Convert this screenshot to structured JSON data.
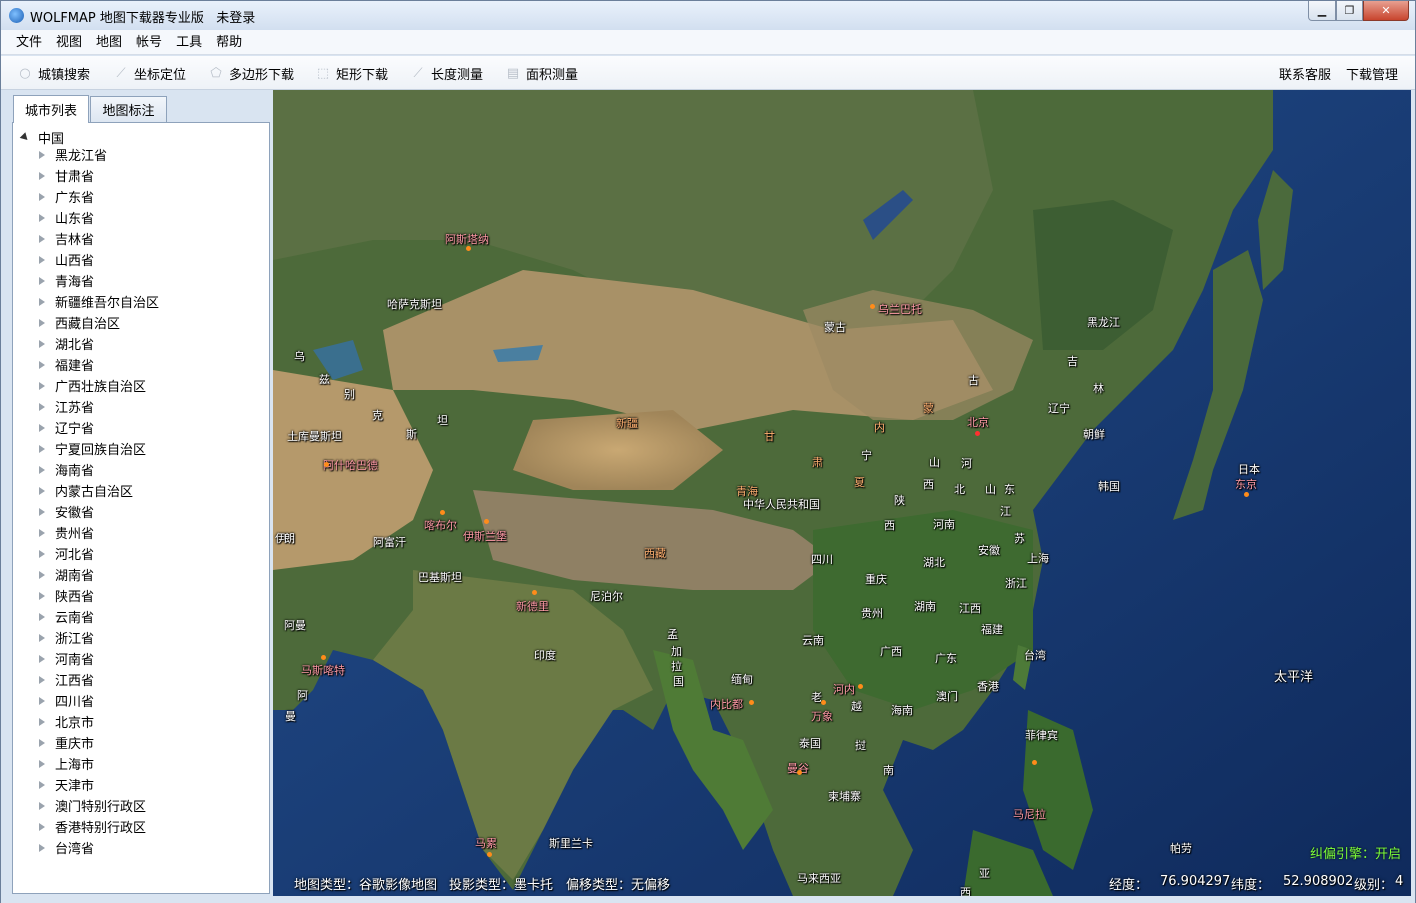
{
  "window": {
    "title": "WOLFMAP 地图下载器专业版",
    "login_status": "未登录"
  },
  "menu": [
    "文件",
    "视图",
    "地图",
    "帐号",
    "工具",
    "帮助"
  ],
  "toolbar": {
    "city_search": "城镇搜索",
    "coord_locate": "坐标定位",
    "polygon_download": "多边形下载",
    "rect_download": "矩形下载",
    "length_measure": "长度测量",
    "area_measure": "面积测量",
    "contact": "联系客服",
    "download_manager": "下载管理"
  },
  "tabs": [
    "城市列表",
    "地图标注"
  ],
  "tree": {
    "root": "中国",
    "items": [
      "黑龙江省",
      "甘肃省",
      "广东省",
      "山东省",
      "吉林省",
      "山西省",
      "青海省",
      "新疆维吾尔自治区",
      "西藏自治区",
      "湖北省",
      "福建省",
      "广西壮族自治区",
      "江苏省",
      "辽宁省",
      "宁夏回族自治区",
      "海南省",
      "内蒙古自治区",
      "安徽省",
      "贵州省",
      "河北省",
      "湖南省",
      "陕西省",
      "云南省",
      "浙江省",
      "河南省",
      "江西省",
      "四川省",
      "北京市",
      "重庆市",
      "上海市",
      "天津市",
      "澳门特别行政区",
      "香港特别行政区",
      "台湾省"
    ]
  },
  "map": {
    "labels": [
      {
        "t": "阿斯塔纳",
        "c": "p"
      },
      {
        "t": "乌兰巴托",
        "c": "p"
      },
      {
        "t": "哈萨克斯坦",
        "c": "w"
      },
      {
        "t": "蒙古",
        "c": "w"
      },
      {
        "t": "黑龙江",
        "c": "w"
      },
      {
        "t": "吉",
        "c": "w"
      },
      {
        "t": "林",
        "c": "w"
      },
      {
        "t": "古",
        "c": "w"
      },
      {
        "t": "辽宁",
        "c": "w"
      },
      {
        "t": "乌",
        "c": "w"
      },
      {
        "t": "兹",
        "c": "w"
      },
      {
        "t": "别",
        "c": "w"
      },
      {
        "t": "克",
        "c": "w"
      },
      {
        "t": "坦",
        "c": "w"
      },
      {
        "t": "斯",
        "c": "w"
      },
      {
        "t": "北京",
        "c": "p"
      },
      {
        "t": "蒙",
        "c": "o"
      },
      {
        "t": "内",
        "c": "o"
      },
      {
        "t": "朝鲜",
        "c": "w"
      },
      {
        "t": "日本",
        "c": "w"
      },
      {
        "t": "东京",
        "c": "p"
      },
      {
        "t": "韩国",
        "c": "w"
      },
      {
        "t": "土库曼斯坦",
        "c": "w"
      },
      {
        "t": "阿什哈巴德",
        "c": "p"
      },
      {
        "t": "新疆",
        "c": "o"
      },
      {
        "t": "甘",
        "c": "o"
      },
      {
        "t": "肃",
        "c": "o"
      },
      {
        "t": "宁",
        "c": "w"
      },
      {
        "t": "夏",
        "c": "o"
      },
      {
        "t": "山",
        "c": "w"
      },
      {
        "t": "河",
        "c": "w"
      },
      {
        "t": "西",
        "c": "w"
      },
      {
        "t": "北",
        "c": "w"
      },
      {
        "t": "山",
        "c": "w"
      },
      {
        "t": "东",
        "c": "w"
      },
      {
        "t": "青海",
        "c": "o"
      },
      {
        "t": "中华人民共和国",
        "c": "w"
      },
      {
        "t": "陕",
        "c": "w"
      },
      {
        "t": "江",
        "c": "w"
      },
      {
        "t": "苏",
        "c": "w"
      },
      {
        "t": "西",
        "c": "w"
      },
      {
        "t": "河南",
        "c": "w"
      },
      {
        "t": "上海",
        "c": "w"
      },
      {
        "t": "安徽",
        "c": "w"
      },
      {
        "t": "阿富汗",
        "c": "w"
      },
      {
        "t": "喀布尔",
        "c": "p"
      },
      {
        "t": "伊斯兰堡",
        "c": "p"
      },
      {
        "t": "西藏",
        "c": "o"
      },
      {
        "t": "四川",
        "c": "w"
      },
      {
        "t": "湖北",
        "c": "w"
      },
      {
        "t": "浙江",
        "c": "w"
      },
      {
        "t": "重庆",
        "c": "w"
      },
      {
        "t": "巴基斯坦",
        "c": "w"
      },
      {
        "t": "贵州",
        "c": "w"
      },
      {
        "t": "湖南",
        "c": "w"
      },
      {
        "t": "江西",
        "c": "w"
      },
      {
        "t": "福建",
        "c": "w"
      },
      {
        "t": "新德里",
        "c": "p"
      },
      {
        "t": "尼泊尔",
        "c": "w"
      },
      {
        "t": "云南",
        "c": "w"
      },
      {
        "t": "孟",
        "c": "w"
      },
      {
        "t": "加",
        "c": "w"
      },
      {
        "t": "拉",
        "c": "w"
      },
      {
        "t": "国",
        "c": "w"
      },
      {
        "t": "广西",
        "c": "w"
      },
      {
        "t": "广东",
        "c": "w"
      },
      {
        "t": "台湾",
        "c": "w"
      },
      {
        "t": "太平洋",
        "c": "w"
      },
      {
        "t": "阿曼",
        "c": "w"
      },
      {
        "t": "马斯喀特",
        "c": "p"
      },
      {
        "t": "印度",
        "c": "w"
      },
      {
        "t": "缅甸",
        "c": "w"
      },
      {
        "t": "河内",
        "c": "p"
      },
      {
        "t": "香港",
        "c": "w"
      },
      {
        "t": "澳门",
        "c": "w"
      },
      {
        "t": "阿",
        "c": "w"
      },
      {
        "t": "曼",
        "c": "w"
      },
      {
        "t": "内比都",
        "c": "p"
      },
      {
        "t": "老",
        "c": "w"
      },
      {
        "t": "万象",
        "c": "p"
      },
      {
        "t": "越",
        "c": "w"
      },
      {
        "t": "海南",
        "c": "w"
      },
      {
        "t": "泰国",
        "c": "w"
      },
      {
        "t": "挝",
        "c": "w"
      },
      {
        "t": "菲律宾",
        "c": "w"
      },
      {
        "t": "曼谷",
        "c": "p"
      },
      {
        "t": "南",
        "c": "w"
      },
      {
        "t": "马尼拉",
        "c": "p"
      },
      {
        "t": "柬埔寨",
        "c": "w"
      },
      {
        "t": "马累",
        "c": "p"
      },
      {
        "t": "斯里兰卡",
        "c": "w"
      },
      {
        "t": "帕劳",
        "c": "w"
      },
      {
        "t": "马来西亚",
        "c": "w"
      },
      {
        "t": "亚",
        "c": "w"
      },
      {
        "t": "西",
        "c": "w"
      },
      {
        "t": "伊",
        "c": "w"
      },
      {
        "t": "朗",
        "c": "w"
      }
    ]
  },
  "status": {
    "map_type": "地图类型：谷歌影像地图",
    "projection": "投影类型：墨卡托",
    "offset": "偏移类型：无偏移",
    "lon_label": "经度：",
    "lon": "76.904297",
    "lat_label": "纬度：",
    "lat": "52.908902",
    "level_label": "级别：",
    "level": "4",
    "engine": "纠偏引擎：开启"
  }
}
